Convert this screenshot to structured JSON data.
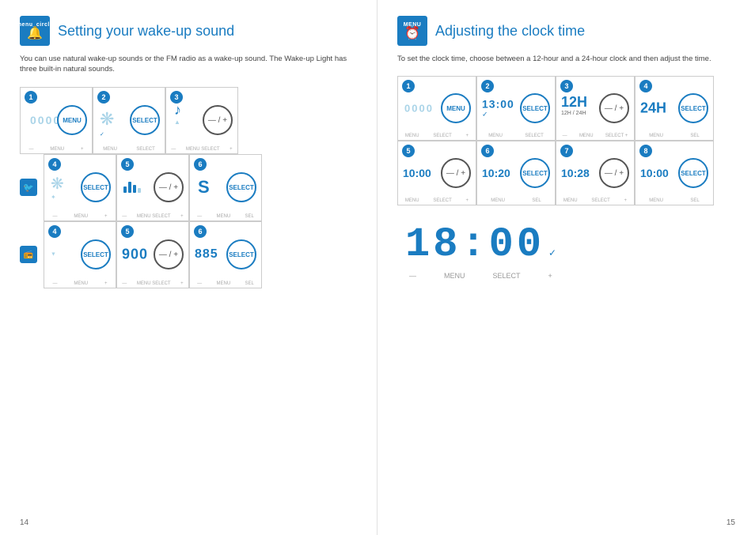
{
  "left": {
    "title": "Setting your wake-up sound",
    "description": "You can use natural wake-up sounds or the FM radio as a wake-up sound. The Wake-up Light has three built-in natural sounds.",
    "page_number": "14",
    "steps_row1": [
      {
        "number": "1",
        "type": "menu_circle",
        "digits": "0000",
        "bottom": [
          "—",
          "MENU",
          "+"
        ]
      },
      {
        "number": "2",
        "type": "select_circle",
        "content": "birds",
        "bottom": [
          "MENU",
          "SELECT",
          ""
        ]
      },
      {
        "number": "3",
        "type": "plus_minus",
        "digits": "♪",
        "bottom": [
          "—",
          "MENU SELECT",
          "+"
        ]
      }
    ],
    "row2_icon": "bird",
    "steps_row2": [
      {
        "number": "4",
        "type": "select_circle",
        "content": "bird_blue",
        "bottom": [
          "—",
          "MENU",
          "+"
        ]
      },
      {
        "number": "5",
        "type": "plus_minus",
        "digits": "|||",
        "bottom": [
          "—",
          "MENU SELECT",
          "+"
        ]
      },
      {
        "number": "6",
        "type": "select_circle",
        "digits": "S",
        "bottom": [
          "—",
          "MENU",
          "SEL"
        ]
      }
    ],
    "row3_icon": "radio",
    "steps_row3": [
      {
        "number": "4",
        "type": "select_circle",
        "content": "radio",
        "bottom": [
          "—",
          "MENU",
          "+"
        ]
      },
      {
        "number": "5",
        "type": "plus_minus",
        "digits": "900",
        "bottom": [
          "—",
          "MENU SELECT",
          "+"
        ]
      },
      {
        "number": "6",
        "type": "select_circle",
        "digits": "885",
        "bottom": [
          "—",
          "MENU",
          "SEL"
        ]
      }
    ]
  },
  "right": {
    "title": "Adjusting the clock time",
    "description": "To set the clock time, choose between a 12-hour and a 24-hour clock and then adjust the time.",
    "page_number": "15",
    "steps_row1": [
      {
        "number": "1",
        "type": "menu_circle",
        "digits": "0000",
        "bottom": [
          "MENU",
          "SELECT",
          "+"
        ]
      },
      {
        "number": "2",
        "type": "select_circle",
        "digits": "13:00",
        "bottom": [
          "MENU",
          "SELECT",
          ""
        ]
      },
      {
        "number": "3",
        "type": "plus_minus",
        "digits": "12H",
        "label": "12H/24H",
        "bottom": [
          "—",
          "MENU",
          "SELECT +"
        ]
      },
      {
        "number": "4",
        "type": "select_circle",
        "digits": "24H",
        "bottom": [
          "MENU",
          "SEL",
          ""
        ]
      }
    ],
    "steps_row2": [
      {
        "number": "5",
        "type": "plus_minus",
        "digits": "10:00",
        "bottom": [
          "MENU",
          "SELECT",
          "+"
        ]
      },
      {
        "number": "6",
        "type": "select_circle",
        "digits": "10:20",
        "bottom": [
          "MENU",
          "SEL",
          ""
        ]
      },
      {
        "number": "7",
        "type": "plus_minus",
        "digits": "10:28",
        "bottom": [
          "MENU",
          "SELECT",
          "+"
        ]
      },
      {
        "number": "8",
        "type": "select_circle",
        "digits": "10:00",
        "bottom": [
          "MENU",
          "SEL",
          ""
        ]
      }
    ],
    "large_display": {
      "digits": "18:00",
      "bottom_labels": [
        "—",
        "MENU",
        "SELECT",
        "+"
      ]
    }
  }
}
